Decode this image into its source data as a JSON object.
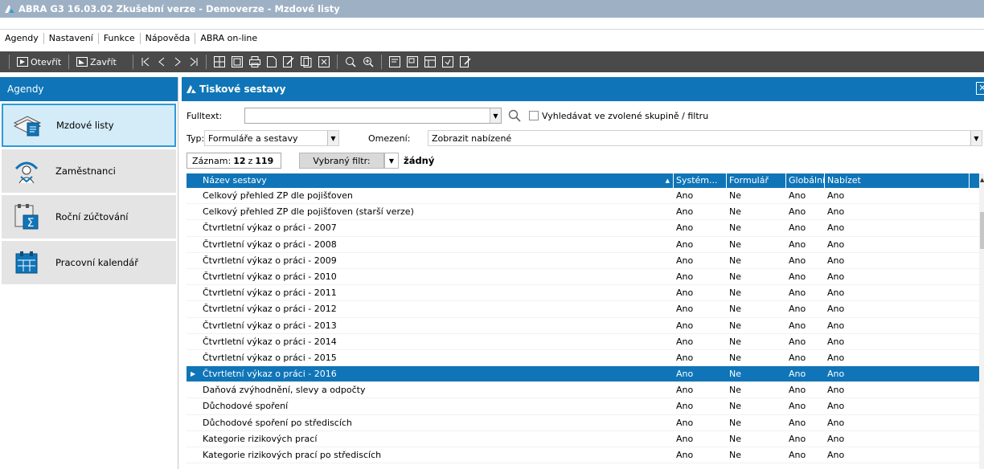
{
  "window": {
    "title": "ABRA G3 16.03.02 Zkušební verze - Demoverze - Mzdové listy"
  },
  "menu": [
    "Agendy",
    "Nastavení",
    "Funkce",
    "Nápověda",
    "ABRA on-line"
  ],
  "toolbar": {
    "open_label": "Otevřít",
    "close_label": "Zavřít"
  },
  "agenda_panel": {
    "title": "Agendy",
    "items": [
      {
        "label": "Mzdové listy",
        "icon": "payroll-sheets-icon",
        "active": true
      },
      {
        "label": "Zaměstnanci",
        "icon": "employees-icon",
        "active": false
      },
      {
        "label": "Roční zúčtování",
        "icon": "annual-settlement-icon",
        "active": false
      },
      {
        "label": "Pracovní kalendář",
        "icon": "calendar-icon",
        "active": false
      }
    ]
  },
  "report_panel": {
    "title": "Tiskové sestavy",
    "fulltext_label": "Fulltext:",
    "fulltext_value": "",
    "search_in_group_label": "Vyhledávat ve zvolené skupině / filtru",
    "type_label": "Typ:",
    "type_value": "Formuláře a sestavy",
    "restriction_label": "Omezení:",
    "restriction_value": "Zobrazit nabízené",
    "record_prefix": "Záznam:",
    "record_current": "12",
    "record_sep": "z",
    "record_total": "119",
    "selected_filter_label": "Vybraný filtr:",
    "selected_filter_value": "žádný"
  },
  "grid": {
    "columns": [
      "Název sestavy",
      "Systém...",
      "Formulář",
      "Globální",
      "Nabízet"
    ],
    "rows": [
      [
        "Celkový přehled ZP dle pojišťoven",
        "Ano",
        "Ne",
        "Ano",
        "Ano"
      ],
      [
        "Celkový přehled ZP dle pojišťoven (starší verze)",
        "Ano",
        "Ne",
        "Ano",
        "Ano"
      ],
      [
        "Čtvrtletní výkaz o práci - 2007",
        "Ano",
        "Ne",
        "Ano",
        "Ano"
      ],
      [
        "Čtvrtletní výkaz o práci - 2008",
        "Ano",
        "Ne",
        "Ano",
        "Ano"
      ],
      [
        "Čtvrtletní výkaz o práci - 2009",
        "Ano",
        "Ne",
        "Ano",
        "Ano"
      ],
      [
        "Čtvrtletní výkaz o práci - 2010",
        "Ano",
        "Ne",
        "Ano",
        "Ano"
      ],
      [
        "Čtvrtletní výkaz o práci - 2011",
        "Ano",
        "Ne",
        "Ano",
        "Ano"
      ],
      [
        "Čtvrtletní výkaz o práci - 2012",
        "Ano",
        "Ne",
        "Ano",
        "Ano"
      ],
      [
        "Čtvrtletní výkaz o práci - 2013",
        "Ano",
        "Ne",
        "Ano",
        "Ano"
      ],
      [
        "Čtvrtletní výkaz o práci - 2014",
        "Ano",
        "Ne",
        "Ano",
        "Ano"
      ],
      [
        "Čtvrtletní výkaz o práci - 2015",
        "Ano",
        "Ne",
        "Ano",
        "Ano"
      ],
      [
        "Čtvrtletní výkaz o práci - 2016",
        "Ano",
        "Ne",
        "Ano",
        "Ano"
      ],
      [
        "Daňová zvýhodnění, slevy a odpočty",
        "Ano",
        "Ne",
        "Ano",
        "Ano"
      ],
      [
        "Důchodové spoření",
        "Ano",
        "Ne",
        "Ano",
        "Ano"
      ],
      [
        "Důchodové spoření po střediscích",
        "Ano",
        "Ne",
        "Ano",
        "Ano"
      ],
      [
        "Kategorie rizikových prací",
        "Ano",
        "Ne",
        "Ano",
        "Ano"
      ],
      [
        "Kategorie rizikových prací po střediscích",
        "Ano",
        "Ne",
        "Ano",
        "Ano"
      ]
    ],
    "selected_index": 11
  },
  "colors": {
    "accent": "#0f75b8",
    "toolbar_bg": "#4a4a4a",
    "title_bg": "#9eb0c4"
  }
}
